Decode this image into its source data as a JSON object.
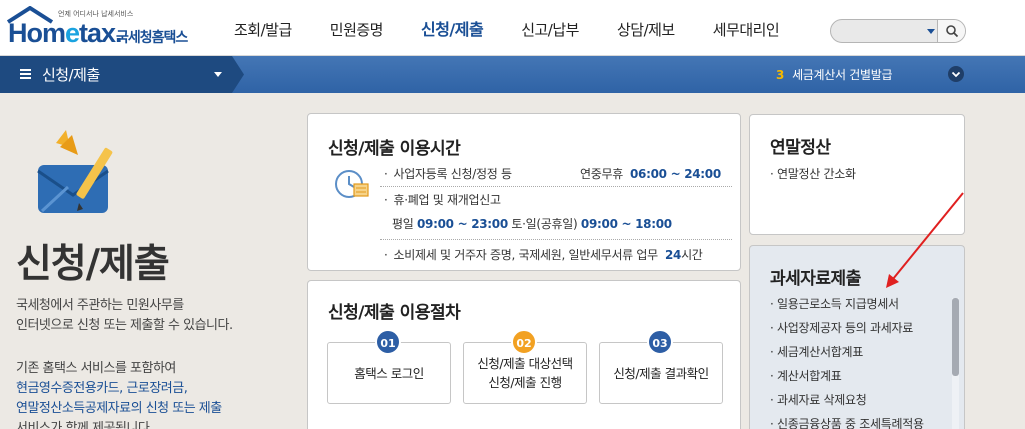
{
  "header": {
    "logo_word_pre": "Hom",
    "logo_word_e": "e",
    "logo_word_post": "tax.",
    "logo_tagline": "언제 어디서나 납세서비스",
    "logo_korean": "국세청홈택스",
    "nav": [
      "조회/발급",
      "민원증명",
      "신청/제출",
      "신고/납부",
      "상담/제보",
      "세무대리인"
    ],
    "active_nav": "신청/제출",
    "search_value": ""
  },
  "bluebar": {
    "breadcrumb": "신청/제출",
    "notice_number": "3",
    "notice_text": "세금계산서 건별발급"
  },
  "intro": {
    "title": "신청/제출",
    "desc_line1": "국세청에서 주관하는 민원사무를",
    "desc_line2": "인터넷으로 신청 또는 제출할 수 있습니다.",
    "desc2_line1": "기존 홈택스 서비스를 포함하여",
    "desc2_line2": "현금영수증전용카드, 근로장려금,",
    "desc2_line3": "연말정산소득공제자료의 신청 또는 제출",
    "desc2_line4": "서비스가 함께 제공됩니다."
  },
  "time_panel": {
    "title": "신청/제출 이용시간",
    "row1_label": "사업자등록 신청/정정 등",
    "row1_days": "연중무휴",
    "row1_hours": "06:00 ~ 24:00",
    "row2_label": "휴·폐업 및 재개업신고",
    "row3_weekday": "평일",
    "row3_weekday_hours": "09:00 ~ 23:00",
    "row3_weekend": "토·일(공휴일)",
    "row3_weekend_hours": "09:00 ~ 18:00",
    "row4_label": "소비제세 및 거주자 증명, 국제세원, 일반세무서류 업무",
    "row4_hours": "24",
    "row4_unit": "시간"
  },
  "process_panel": {
    "title": "신청/제출 이용절차",
    "steps": [
      {
        "num": "01",
        "line1": "홈택스 로그인",
        "line2": ""
      },
      {
        "num": "02",
        "line1": "신청/제출 대상선택",
        "line2": "신청/제출 진행"
      },
      {
        "num": "03",
        "line1": "신청/제출 결과확인",
        "line2": ""
      }
    ]
  },
  "year_panel": {
    "title": "연말정산",
    "items": [
      "연말정산 간소화"
    ]
  },
  "tax_panel": {
    "title": "과세자료제출",
    "items": [
      "일용근로소득 지급명세서",
      "사업장제공자 등의 과세자료",
      "세금계산서합계표",
      "계산서합계표",
      "과세자료 삭제요청",
      "신종금융상품 중 조세특례적용"
    ]
  },
  "colors": {
    "brand_blue": "#1a4f95",
    "bar_blue": "#3a6fb0",
    "badge_orange": "#f2a122",
    "annotation_red": "#e02020"
  },
  "icons": [
    "search-icon",
    "menu-icon",
    "chevron-down-icon",
    "envelope-pencil-icon",
    "clock-calendar-icon"
  ]
}
